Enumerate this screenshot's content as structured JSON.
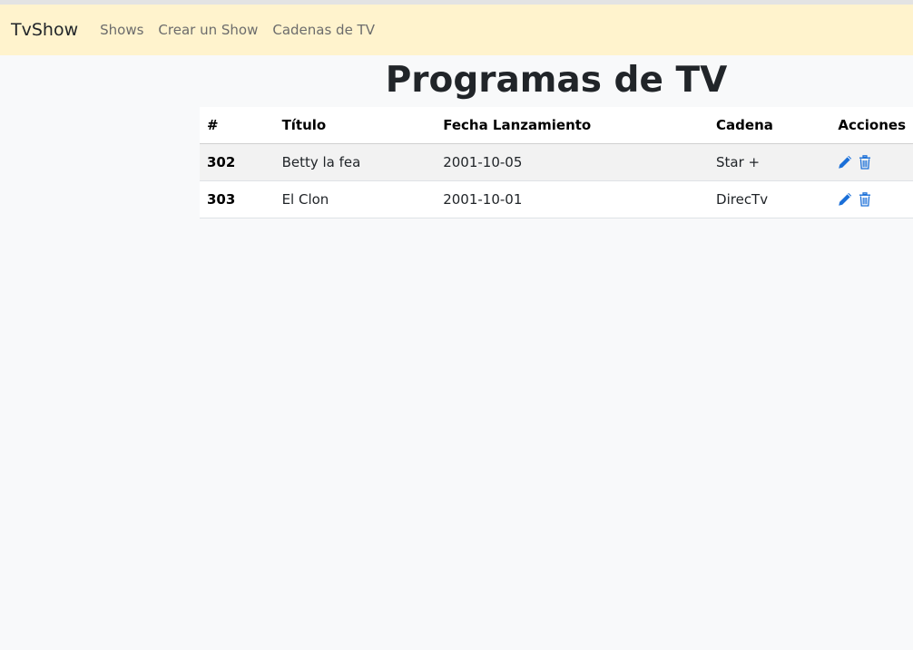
{
  "navbar": {
    "brand": "TvShow",
    "links": [
      "Shows",
      "Crear un Show",
      "Cadenas de TV"
    ]
  },
  "page": {
    "title": "Programas de TV"
  },
  "table": {
    "headers": [
      "#",
      "Título",
      "Fecha Lanzamiento",
      "Cadena",
      "Acciones"
    ],
    "rows": [
      {
        "id": "302",
        "title": "Betty la fea",
        "date": "2001-10-05",
        "channel": "Star +"
      },
      {
        "id": "303",
        "title": "El Clon",
        "date": "2001-10-01",
        "channel": "DirecTv"
      }
    ]
  },
  "icons": {
    "edit": "pencil-icon",
    "delete": "trash-icon"
  },
  "colors": {
    "navbar_bg": "#fff3cd",
    "page_bg": "#f8f9fa",
    "icon_blue": "#1a6fd8"
  }
}
